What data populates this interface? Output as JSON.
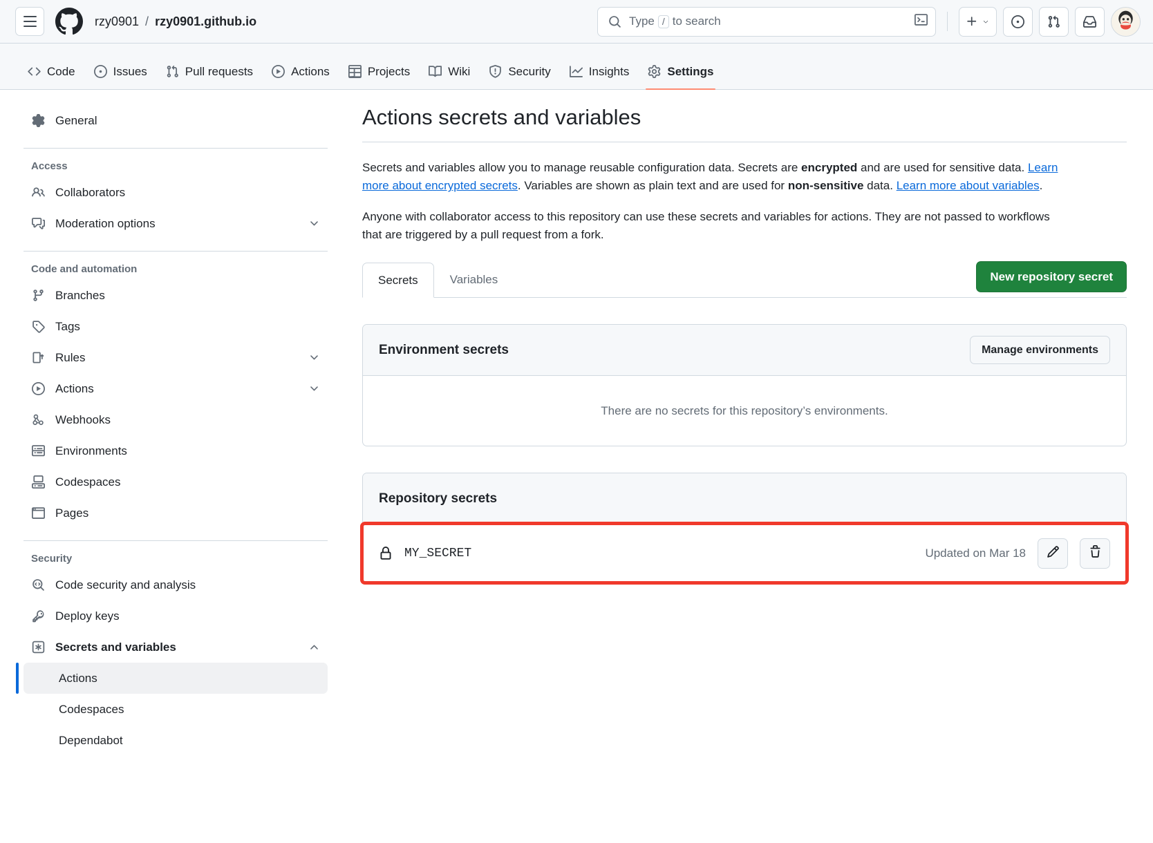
{
  "header": {
    "menu_icon": "hamburger-icon",
    "logo_icon": "github-mark-icon",
    "owner": "rzy0901",
    "separator": "/",
    "repo": "rzy0901.github.io",
    "search": {
      "placeholder_prefix": "Type",
      "slash_key": "/",
      "placeholder_suffix": "to search",
      "value": "",
      "terminal_icon": "command-palette-icon"
    },
    "actions": [
      {
        "name": "create-new-menu",
        "icon": "plus-icon",
        "caret": "▾"
      },
      {
        "name": "issues-button",
        "icon": "issue-opened-icon"
      },
      {
        "name": "pull-requests-button",
        "icon": "git-pull-request-icon"
      },
      {
        "name": "notifications-button",
        "icon": "inbox-icon"
      }
    ],
    "avatar": "user-avatar"
  },
  "repo_nav": {
    "tabs": [
      {
        "label": "Code",
        "icon": "code-icon",
        "active": false
      },
      {
        "label": "Issues",
        "icon": "issue-opened-icon",
        "active": false
      },
      {
        "label": "Pull requests",
        "icon": "git-pull-request-icon",
        "active": false
      },
      {
        "label": "Actions",
        "icon": "play-icon",
        "active": false
      },
      {
        "label": "Projects",
        "icon": "table-icon",
        "active": false
      },
      {
        "label": "Wiki",
        "icon": "book-icon",
        "active": false
      },
      {
        "label": "Security",
        "icon": "shield-icon",
        "active": false
      },
      {
        "label": "Insights",
        "icon": "graph-icon",
        "active": false
      },
      {
        "label": "Settings",
        "icon": "gear-icon",
        "active": true
      }
    ]
  },
  "sidebar": {
    "general": {
      "label": "General",
      "icon": "gear-icon"
    },
    "groups": [
      {
        "heading": "Access",
        "items": [
          {
            "label": "Collaborators",
            "icon": "people-icon",
            "chevron": ""
          },
          {
            "label": "Moderation options",
            "icon": "comment-discussion-icon",
            "chevron": "down"
          }
        ]
      },
      {
        "heading": "Code and automation",
        "items": [
          {
            "label": "Branches",
            "icon": "git-branch-icon",
            "chevron": ""
          },
          {
            "label": "Tags",
            "icon": "tag-icon",
            "chevron": ""
          },
          {
            "label": "Rules",
            "icon": "rules-icon",
            "chevron": "down"
          },
          {
            "label": "Actions",
            "icon": "play-icon",
            "chevron": "down"
          },
          {
            "label": "Webhooks",
            "icon": "webhook-icon",
            "chevron": ""
          },
          {
            "label": "Environments",
            "icon": "server-icon",
            "chevron": ""
          },
          {
            "label": "Codespaces",
            "icon": "codespaces-icon",
            "chevron": ""
          },
          {
            "label": "Pages",
            "icon": "browser-icon",
            "chevron": ""
          }
        ]
      },
      {
        "heading": "Security",
        "items": [
          {
            "label": "Code security and analysis",
            "icon": "codescan-icon",
            "chevron": ""
          },
          {
            "label": "Deploy keys",
            "icon": "key-icon",
            "chevron": ""
          },
          {
            "label": "Secrets and variables",
            "icon": "secrets-icon",
            "chevron": "up",
            "bold": true
          }
        ],
        "subitems": [
          {
            "label": "Actions",
            "selected": true
          },
          {
            "label": "Codespaces",
            "selected": false
          },
          {
            "label": "Dependabot",
            "selected": false
          }
        ]
      }
    ]
  },
  "main": {
    "title": "Actions secrets and variables",
    "paragraph1": {
      "p1": "Secrets and variables allow you to manage reusable configuration data. Secrets are ",
      "b1": "encrypted",
      "p2": " and are used for sensitive data. ",
      "link1": "Learn more about encrypted secrets",
      "p3": ". Variables are shown as plain text and are used for ",
      "b2": "non-sensitive",
      "p4": " data. ",
      "link2": "Learn more about variables",
      "p5": "."
    },
    "paragraph2": "Anyone with collaborator access to this repository can use these secrets and variables for actions. They are not passed to workflows that are triggered by a pull request from a fork.",
    "tabs": [
      {
        "label": "Secrets",
        "active": true
      },
      {
        "label": "Variables",
        "active": false
      }
    ],
    "new_secret_button": "New repository secret",
    "environment_panel": {
      "title": "Environment secrets",
      "manage_button": "Manage environments",
      "empty_text": "There are no secrets for this repository’s environments."
    },
    "repository_panel": {
      "title": "Repository secrets",
      "secrets": [
        {
          "name": "MY_SECRET",
          "lock_icon": "lock-icon",
          "updated": "Updated on Mar 18",
          "edit_icon": "pencil-icon",
          "delete_icon": "trash-icon",
          "highlighted": true
        }
      ]
    }
  },
  "colors": {
    "accent_green": "#1f833d",
    "link_blue": "#0969da",
    "selected_blue": "#0969da",
    "active_tab_underline": "#fd8c73",
    "highlight_red": "#f0392b",
    "canvas_subtle": "#f6f8fa",
    "border": "#d1d9e0"
  }
}
